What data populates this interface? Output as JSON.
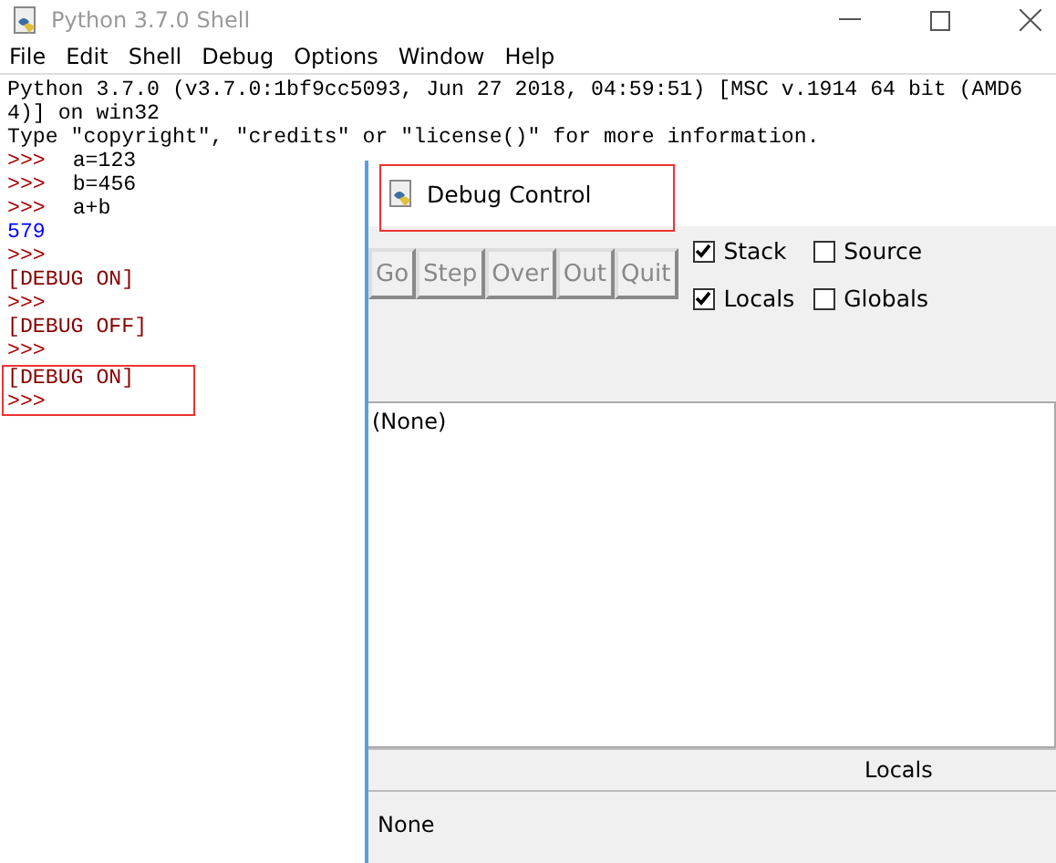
{
  "shell_window": {
    "title": "Python 3.7.0 Shell",
    "menu": [
      "File",
      "Edit",
      "Shell",
      "Debug",
      "Options",
      "Window",
      "Help"
    ],
    "lines": [
      {
        "kind": "info",
        "text": "Python 3.7.0 (v3.7.0:1bf9cc5093, Jun 27 2018, 04:59:51) [MSC v.1914 64 bit (AMD6"
      },
      {
        "kind": "info",
        "text": "4)] on win32"
      },
      {
        "kind": "info",
        "text": "Type \"copyright\", \"credits\" or \"license()\" for more information."
      },
      {
        "kind": "prompt",
        "prompt": ">>>",
        "text": "a=123"
      },
      {
        "kind": "prompt",
        "prompt": ">>>",
        "text": "b=456"
      },
      {
        "kind": "prompt",
        "prompt": ">>>",
        "text": "a+b"
      },
      {
        "kind": "result",
        "text": "579"
      },
      {
        "kind": "prompt",
        "prompt": ">>>"
      },
      {
        "kind": "message",
        "text": "[DEBUG ON]"
      },
      {
        "kind": "prompt",
        "prompt": ">>>"
      },
      {
        "kind": "message",
        "text": "[DEBUG OFF]"
      },
      {
        "kind": "prompt",
        "prompt": ">>>"
      }
    ],
    "highlighted_lines": [
      {
        "kind": "message",
        "text": "[DEBUG ON]"
      },
      {
        "kind": "prompt",
        "prompt": ">>>"
      }
    ]
  },
  "debug_window": {
    "title": "Debug Control",
    "title_highlighted": true,
    "buttons": [
      {
        "label": "Go",
        "disabled": true
      },
      {
        "label": "Step",
        "disabled": true
      },
      {
        "label": "Over",
        "disabled": true
      },
      {
        "label": "Out",
        "disabled": true
      },
      {
        "label": "Quit",
        "disabled": true
      }
    ],
    "options": [
      {
        "label": "Stack",
        "checked": true
      },
      {
        "label": "Source",
        "checked": false
      },
      {
        "label": "Locals",
        "checked": true
      },
      {
        "label": "Globals",
        "checked": false
      }
    ],
    "stack_text": "(None)",
    "locals_header": "Locals",
    "locals_text": "None"
  }
}
